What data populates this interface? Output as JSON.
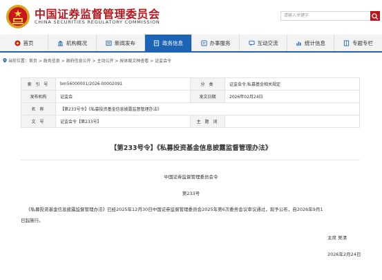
{
  "header": {
    "org_name_cn": "中国证券监督管理委员会",
    "org_name_en": "CHINA SECURITIES REGULATORY COMMISSION",
    "search_placeholder": "请输入关键字"
  },
  "colors": {
    "brand_red": "#b8171d",
    "nav_blue": "#1e64b4"
  },
  "nav": [
    {
      "label": "首页",
      "icon": "home-icon",
      "active": false
    },
    {
      "label": "机构概况",
      "icon": "building-icon",
      "active": false
    },
    {
      "label": "新闻发布",
      "icon": "news-icon",
      "active": false
    },
    {
      "label": "政务信息",
      "icon": "info-icon",
      "active": true
    },
    {
      "label": "办事服务",
      "icon": "service-icon",
      "active": false
    },
    {
      "label": "互动交流",
      "icon": "chat-icon",
      "active": false
    },
    {
      "label": "统计信息",
      "icon": "stats-icon",
      "active": false
    },
    {
      "label": "专题专栏",
      "icon": "column-icon",
      "active": false
    }
  ],
  "breadcrumb": "当前位置：首页 > 政务信息 > 政府信息公开 > 主动公开 > 按体裁文种查看 > 证监会令",
  "meta": {
    "index_label": "索 引 号",
    "index_value": "bm56000001/2026-00002091",
    "category_label": "分 类",
    "category_value": "证监会令;私募基金相关规定",
    "issuer_label": "发布机构",
    "issuer_value": "证监会",
    "date_label": "发文日期",
    "date_value": "2026年02月24日",
    "name_label": "名 称",
    "name_value": "【第233号令】《私募投资基金信息披露监督管理办法》",
    "docno_label": "文 号",
    "docno_value": "证监会令【第233号】",
    "subject_label": "主 题 词",
    "subject_value": ""
  },
  "document": {
    "title": "【第233号令】《私募投资基金信息披露监督管理办法》",
    "issuer_line": "中国证券监督管理委员会令",
    "number_line": "第233号",
    "paragraph_1": "《私募投资基金信息披露监督管理办法》已经2025年12月30日中国证券监督管理委员会2025年第6次委务会议审议通过，现予公布，自2026年9月1",
    "paragraph_2": "日起施行。",
    "signature": "主席  吴清",
    "sign_date": "2026年2月24日"
  }
}
